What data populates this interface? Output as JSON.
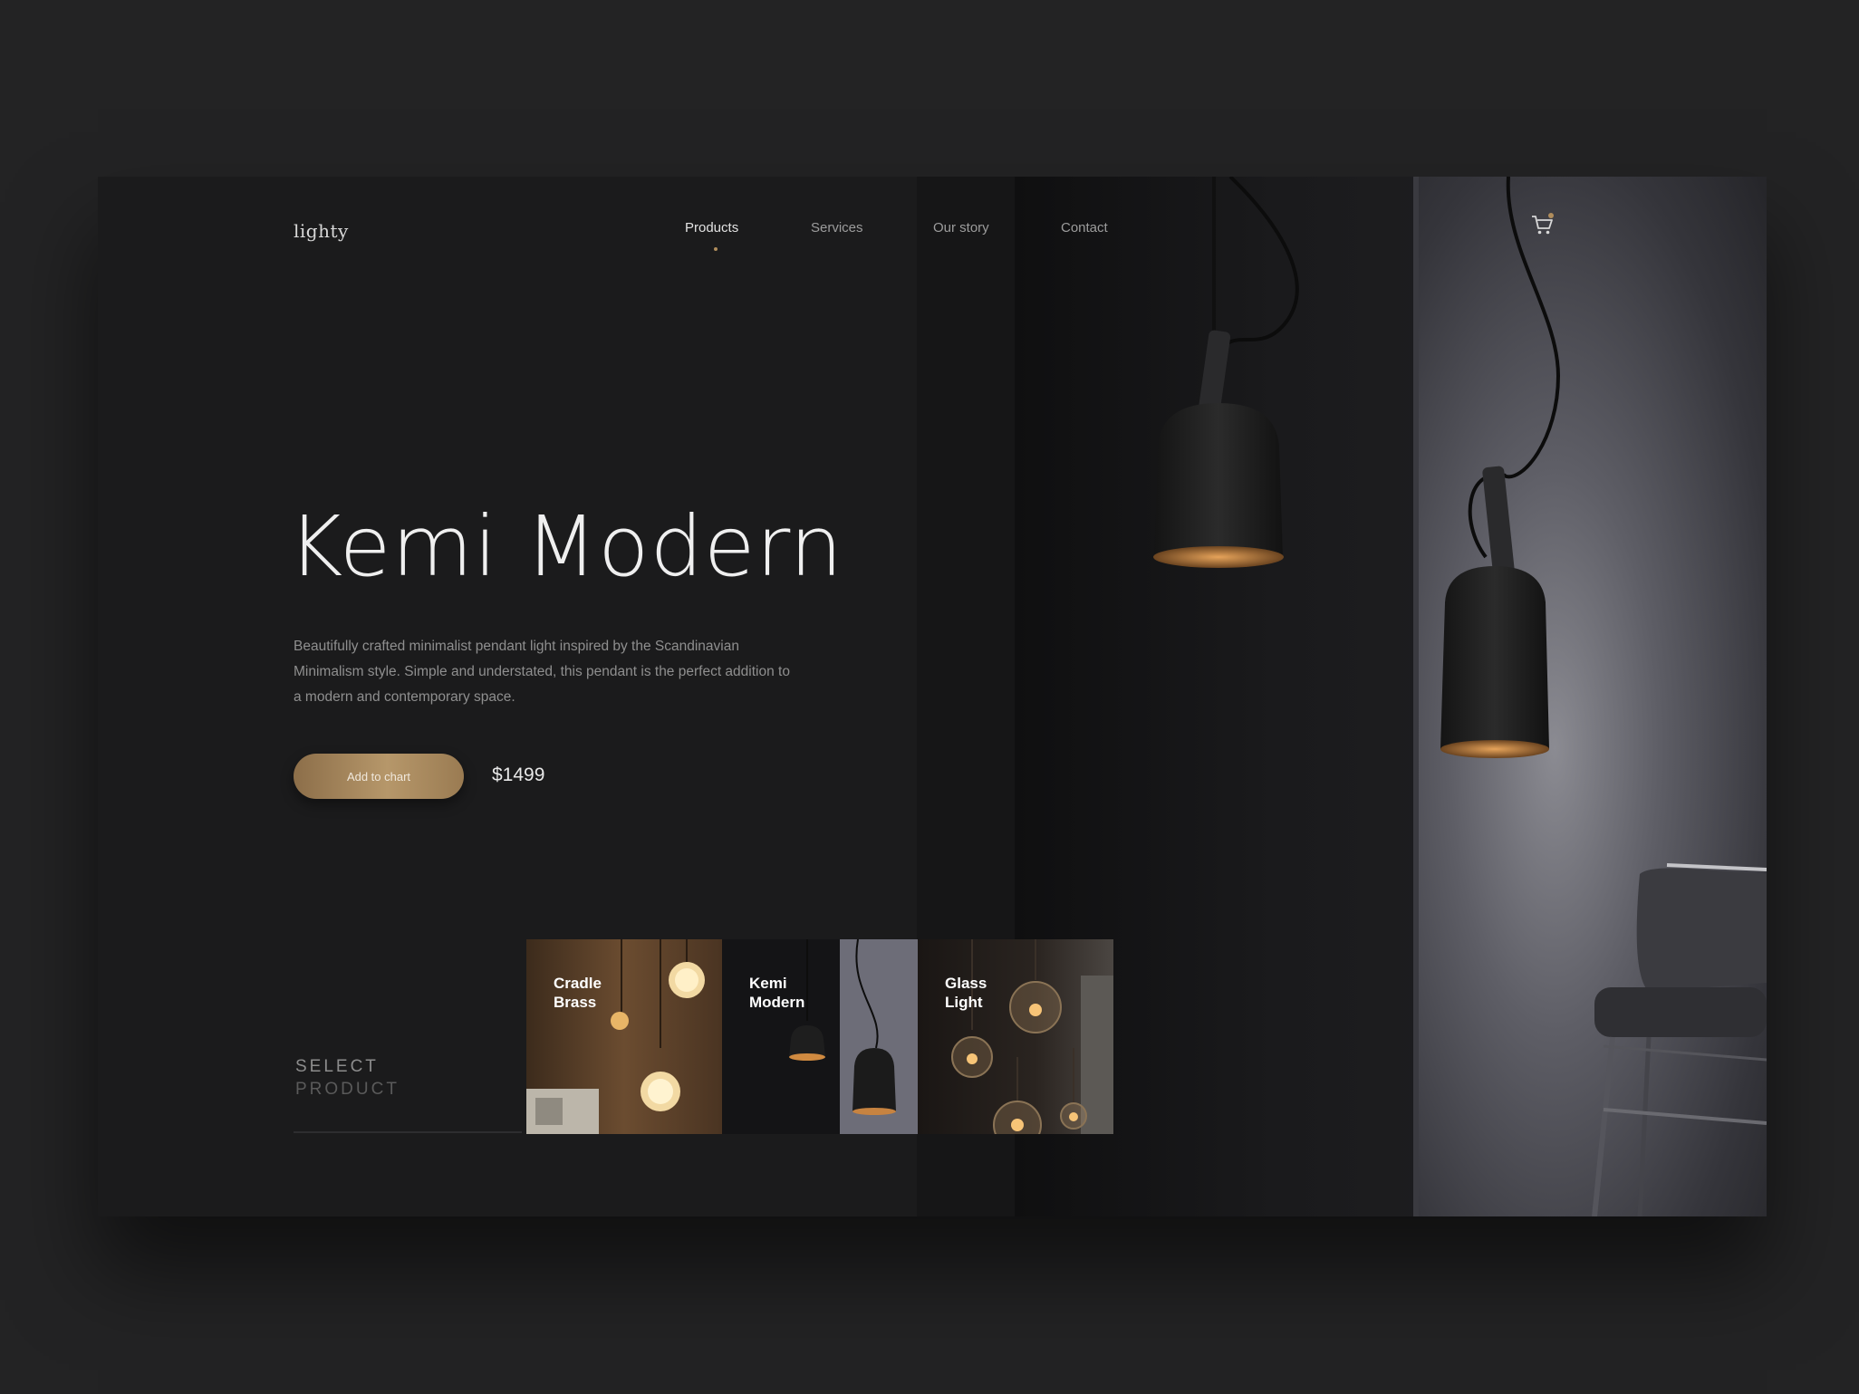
{
  "brand": {
    "logo": "lighty"
  },
  "nav": {
    "items": [
      {
        "label": "Products",
        "active": true
      },
      {
        "label": "Services",
        "active": false
      },
      {
        "label": "Our story",
        "active": false
      },
      {
        "label": "Contact",
        "active": false
      }
    ],
    "cart_icon": "cart-icon"
  },
  "product": {
    "title": "Kemi Modern",
    "description": "Beautifully crafted minimalist pendant light inspired by the Scandinavian Minimalism style. Simple and understated, this pendant is the perfect addition to a modern and contemporary space.",
    "add_button": "Add to chart",
    "price": "$1499"
  },
  "selector": {
    "label_line1": "SELECT",
    "label_line2": "PRODUCT",
    "items": [
      {
        "label": "Cradle Brass"
      },
      {
        "label": "Kemi Modern"
      },
      {
        "label": "Glass Light"
      }
    ]
  },
  "colors": {
    "background": "#232324",
    "card": "#1b1b1c",
    "accent_gold": "#b08d5c",
    "text_primary": "#efefef",
    "text_muted": "#8f8f8f"
  }
}
